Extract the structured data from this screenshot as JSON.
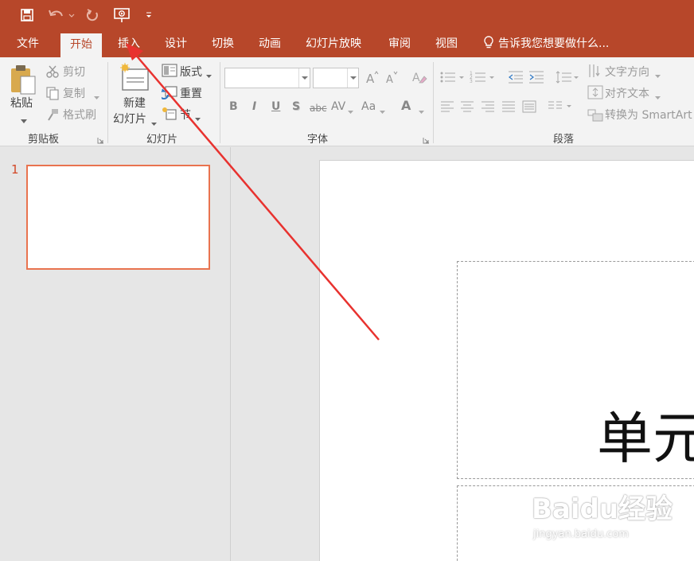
{
  "quick_access": {
    "save_icon": "save-icon",
    "undo_icon": "undo-icon",
    "redo_icon": "redo-icon",
    "present_icon": "start-from-beginning-icon",
    "customize_icon": "customize-qat-icon"
  },
  "tabs": [
    {
      "label": "文件"
    },
    {
      "label": "开始",
      "active": true
    },
    {
      "label": "插入"
    },
    {
      "label": "设计"
    },
    {
      "label": "切换"
    },
    {
      "label": "动画"
    },
    {
      "label": "幻灯片放映"
    },
    {
      "label": "审阅"
    },
    {
      "label": "视图"
    }
  ],
  "tell_me": {
    "text": "告诉我您想要做什么...",
    "icon": "lightbulb-icon"
  },
  "ribbon": {
    "clipboard": {
      "paste": "粘贴",
      "cut": "剪切",
      "copy": "复制",
      "format_painter": "格式刷",
      "group_label": "剪贴板"
    },
    "slides": {
      "new_slide_line1": "新建",
      "new_slide_line2": "幻灯片",
      "layout": "版式",
      "reset": "重置",
      "section": "节",
      "group_label": "幻灯片"
    },
    "font": {
      "font_name_value": "",
      "font_size_value": "",
      "bold": "B",
      "italic": "I",
      "underline": "U",
      "shadow": "S",
      "strikethrough": "abc",
      "spacing": "AV",
      "change_case": "Aa",
      "font_color": "A",
      "group_label": "字体"
    },
    "paragraph": {
      "text_direction": "文字方向",
      "align_text": "对齐文本",
      "convert_smartart": "转换为 SmartArt",
      "group_label": "段落"
    }
  },
  "slide_pane": {
    "slide_number": "1"
  },
  "slide": {
    "title_text": "单元"
  },
  "watermark": {
    "logo": "Baidu经验",
    "url": "jingyan.baidu.com"
  },
  "colors": {
    "accent": "#b7472a",
    "ribbon_bg": "#f3f3f3",
    "thumb_border": "#e9734f",
    "arrow": "#e8322f"
  }
}
